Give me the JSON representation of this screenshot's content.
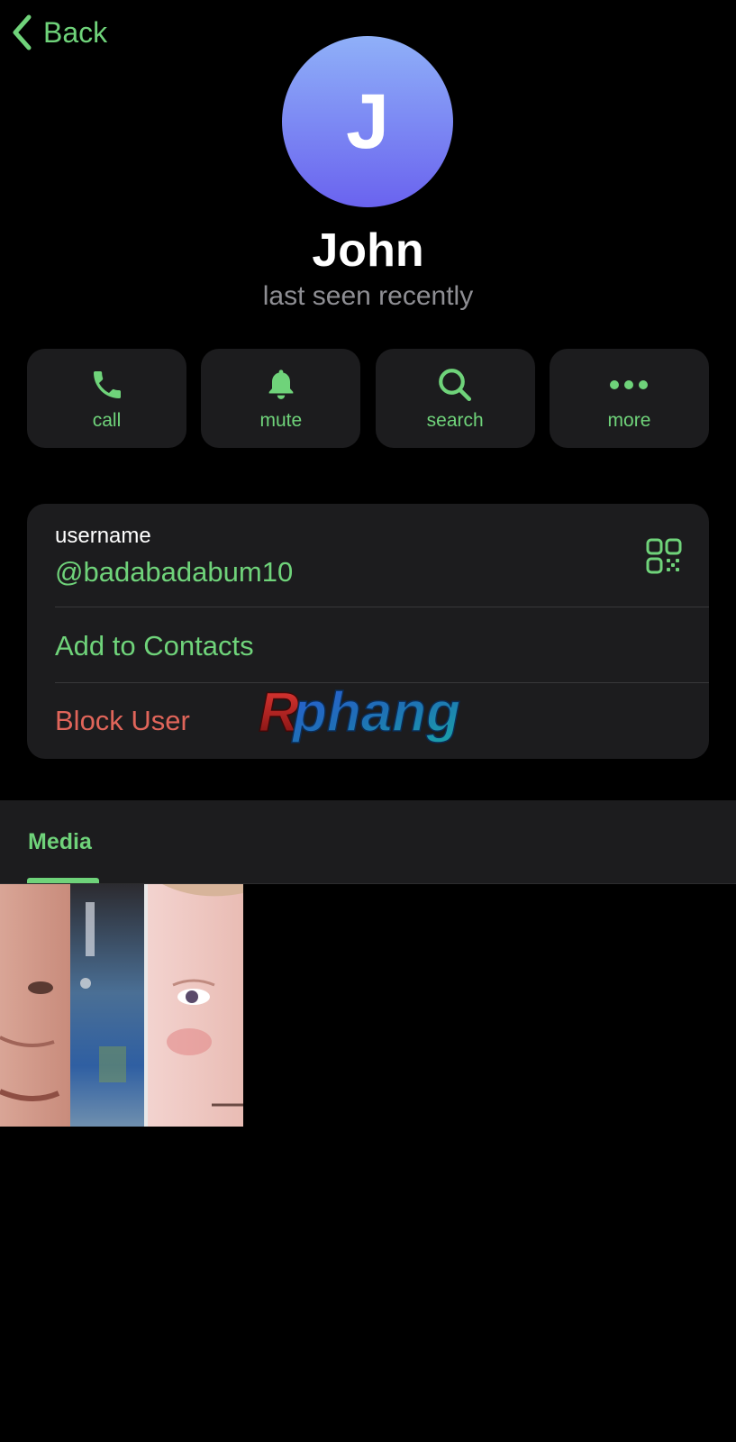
{
  "nav": {
    "back_label": "Back"
  },
  "profile": {
    "avatar_initial": "J",
    "name": "John",
    "status": "last seen recently"
  },
  "actions": [
    {
      "label": "call",
      "icon": "phone-icon"
    },
    {
      "label": "mute",
      "icon": "bell-icon"
    },
    {
      "label": "search",
      "icon": "search-icon"
    },
    {
      "label": "more",
      "icon": "more-icon"
    }
  ],
  "info": {
    "username_label": "username",
    "username_value": "@badabadabum10",
    "add_contacts_label": "Add to Contacts",
    "block_user_label": "Block User"
  },
  "watermark_text": "Rphang",
  "media": {
    "tab_label": "Media"
  },
  "colors": {
    "accent": "#6fd37a",
    "destructive": "#e0655a",
    "background": "#000000",
    "card": "#1c1c1e",
    "secondary_text": "#8e8e93",
    "avatar_top": "#8fb0f8",
    "avatar_bottom": "#6a63ef"
  }
}
